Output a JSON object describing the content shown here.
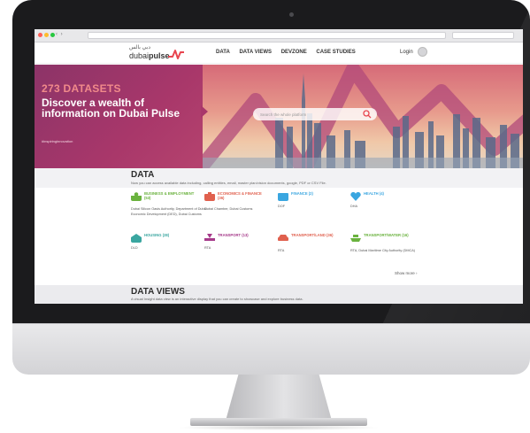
{
  "header": {
    "logo_arabic": "دبي بالس",
    "logo_brand_light": "dubai",
    "logo_brand_bold": "pulse",
    "nav": [
      "DATA",
      "DATA VIEWS",
      "DEVZONE",
      "CASE STUDIES"
    ],
    "login_label": "Login",
    "accent": "#e8454f"
  },
  "hero": {
    "dataset_count": "273 DATASETS",
    "headline": "Discover a wealth of information on Dubai Pulse",
    "hashtag": "#inspiringinnovation",
    "search_placeholder": "Search the whole platform",
    "left_color": "#a8376a",
    "count_color": "#f08a8a"
  },
  "data_section": {
    "title": "DATA",
    "description": "Now you can access available data including, calling entities, email, master plan/vision documents, google, PDF or CSV File.",
    "categories": [
      {
        "title": "BUSINESS & EMPLOYMENT (53)",
        "desc": "Dubai Silicon Oasis Authority, Department of Dubai Economic Development (DED), Dubai Customs",
        "color": "#6ab23e",
        "icon": "business-icon"
      },
      {
        "title": "ECONOMICS & FINANCE (36)",
        "desc": "Dubai Chamber, Dubai Customs",
        "color": "#e0604e",
        "icon": "briefcase-icon"
      },
      {
        "title": "FINANCE (2)",
        "desc": "DOF",
        "color": "#3aa6e0",
        "icon": "wallet-icon"
      },
      {
        "title": "HEALTH (4)",
        "desc": "DHA",
        "color": "#3aa6e0",
        "icon": "heart-icon"
      },
      {
        "title": "HOUSING (28)",
        "desc": "DLD",
        "color": "#3aa6a0",
        "icon": "house-icon"
      },
      {
        "title": "TRANSPORT (13)",
        "desc": "RTA",
        "color": "#a63a8a",
        "icon": "transport-icon"
      },
      {
        "title": "TRANSPORT/LAND (36)",
        "desc": "RTA",
        "color": "#e0604e",
        "icon": "car-icon"
      },
      {
        "title": "TRANSPORT/WATER (16)",
        "desc": "RTA, Dubai Maritime City Authority (DMCA)",
        "color": "#6ab23e",
        "icon": "boat-icon"
      }
    ],
    "show_more": "Show more ›"
  },
  "data_views": {
    "title": "DATA VIEWS",
    "description": "A visual Insight data view is an interactive display that you can create to showcase and explore business data."
  }
}
